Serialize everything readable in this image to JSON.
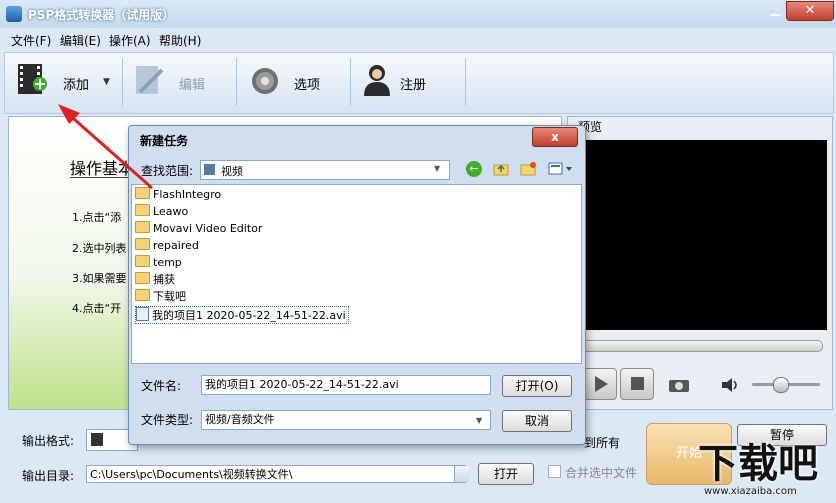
{
  "app": {
    "title": "PSP格式转换器（试用版）"
  },
  "menu": [
    {
      "label": "文件(F)"
    },
    {
      "label": "编辑(E)"
    },
    {
      "label": "操作(A)"
    },
    {
      "label": "帮助(H)"
    }
  ],
  "toolbar": {
    "add_label": "添加",
    "edit_label": "编辑",
    "options_label": "选项",
    "register_label": "注册"
  },
  "steps": {
    "title": "操作基本",
    "items": [
      "1.点击“添",
      "2.选中列表",
      "3.如果需要",
      "4.点击“开"
    ]
  },
  "preview": {
    "title": "预览"
  },
  "bottom": {
    "format_label": "输出格式:",
    "dir_label": "输出目录:",
    "dir_value": "C:\\Users\\pc\\Documents\\视频转换文件\\",
    "open_label": "打开",
    "apply_all_label": "到所有",
    "merge_label": "合并选中文件",
    "start_label": "开始",
    "pause_label": "暂停"
  },
  "dialog": {
    "title": "新建任务",
    "close": "x",
    "lookin_label": "查找范围:",
    "lookin_value": "视频",
    "files": [
      {
        "name": "FlashIntegro",
        "type": "folder"
      },
      {
        "name": "Leawo",
        "type": "folder"
      },
      {
        "name": "Movavi Video Editor",
        "type": "folder"
      },
      {
        "name": "repaired",
        "type": "folder"
      },
      {
        "name": "temp",
        "type": "folder"
      },
      {
        "name": "捕获",
        "type": "folder"
      },
      {
        "name": "下载吧",
        "type": "folder"
      },
      {
        "name": "我的项目1 2020-05-22_14-51-22.avi",
        "type": "file"
      }
    ],
    "filename_label": "文件名:",
    "filename_value": "我的项目1 2020-05-22_14-51-22.avi",
    "filetype_label": "文件类型:",
    "filetype_value": "视频/音频文件",
    "open_button": "打开(O)",
    "cancel_button": "取消"
  },
  "watermark": {
    "text": "下载吧",
    "url": "www.xiazaiba.com"
  },
  "colors": {
    "arrow": "#e02020",
    "accent": "#1f5fb0"
  }
}
